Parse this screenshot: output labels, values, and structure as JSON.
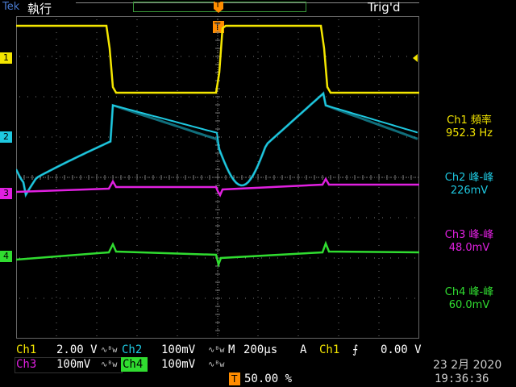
{
  "header": {
    "brand": "Tek",
    "run_state": "執行",
    "trigger_state": "Trig'd",
    "trigger_marker": "T"
  },
  "channels": {
    "ch1": {
      "label": "1",
      "color": "#f4e600"
    },
    "ch2": {
      "label": "2",
      "color": "#1ec8e0"
    },
    "ch3": {
      "label": "3",
      "color": "#e020e0"
    },
    "ch4": {
      "label": "4",
      "color": "#30dc30"
    }
  },
  "measurements": [
    {
      "title": "Ch1 頻率",
      "value": "952.3 Hz",
      "color": "#f4e600"
    },
    {
      "title": "Ch2 峰-峰",
      "value": "226mV",
      "color": "#1ec8e0"
    },
    {
      "title": "Ch3 峰-峰",
      "value": "48.0mV",
      "color": "#e020e0"
    },
    {
      "title": "Ch4 峰-峰",
      "value": "60.0mV",
      "color": "#30dc30"
    }
  ],
  "bottom": {
    "ch1_name": "Ch1",
    "ch1_scale": "2.00 V",
    "ch2_name": "Ch2",
    "ch2_scale": "100mV",
    "ch3_name": "Ch3",
    "ch3_scale": "100mV",
    "ch4_name": "Ch4",
    "ch4_scale": "100mV",
    "bw_symbol": "∿ᴮw",
    "timebase_label": "M",
    "timebase": "200µs",
    "trigger_label": "A",
    "trigger_source": "Ch1",
    "trigger_slope": "⨍",
    "trigger_level": "0.00 V",
    "trigger_pos_marker": "T",
    "trigger_pos": "50.00 %",
    "date": "23 2月  2020",
    "time": "19:36:36"
  }
}
